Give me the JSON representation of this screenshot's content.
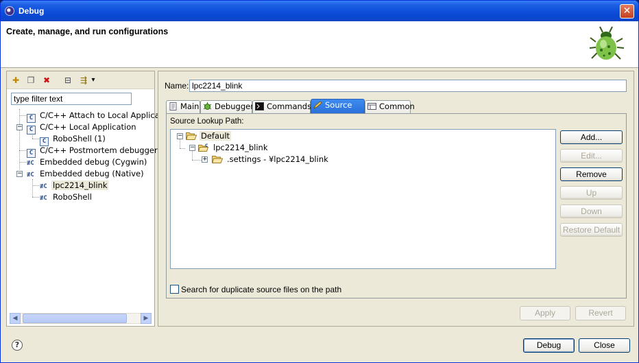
{
  "window": {
    "title": "Debug",
    "close_glyph": "✕"
  },
  "banner": {
    "title": "Create, manage, and run configurations",
    "icon": "bug-icon"
  },
  "left": {
    "toolbar": [
      {
        "name": "new-config-icon",
        "glyph": "✚"
      },
      {
        "name": "duplicate-icon",
        "glyph": "❐"
      },
      {
        "name": "delete-icon",
        "glyph": "✖"
      },
      {
        "name": "collapse-all-icon",
        "glyph": "⊟"
      },
      {
        "name": "filter-icon",
        "glyph": "⇶"
      },
      {
        "name": "dropdown-icon",
        "glyph": "▾"
      }
    ],
    "filter_text": "type filter text",
    "tree": [
      {
        "label": "C/C++ Attach to Local Applicat",
        "icon": "c-app-icon",
        "iconText": "C"
      },
      {
        "label": "C/C++ Local Application",
        "icon": "c-app-icon",
        "iconText": "C"
      },
      {
        "label": "RoboShell (1)",
        "icon": "c-app-icon",
        "iconText": "C"
      },
      {
        "label": "C/C++ Postmortem debugger",
        "icon": "c-app-icon",
        "iconText": "C"
      },
      {
        "label": "Embedded debug (Cygwin)",
        "icon": "embedded-icon",
        "iconText": "≢C"
      },
      {
        "label": "Embedded debug (Native)",
        "icon": "embedded-icon",
        "iconText": "≢C"
      },
      {
        "label": "lpc2214_blink",
        "icon": "embedded-icon",
        "iconText": "≢C"
      },
      {
        "label": "RoboShell",
        "icon": "embedded-icon",
        "iconText": "≢C"
      }
    ],
    "expand_minus": "−",
    "scroll_left": "◀",
    "scroll_right": "▶"
  },
  "right": {
    "name_label": "Name:",
    "name_value": "lpc2214_blink",
    "tabs": [
      {
        "label": "Main",
        "icon": "main-tab-icon"
      },
      {
        "label": "Debugger",
        "icon": "debugger-tab-icon"
      },
      {
        "label": "Commands",
        "icon": "commands-tab-icon"
      },
      {
        "label": "Source",
        "icon": "source-tab-icon"
      },
      {
        "label": "Common",
        "icon": "common-tab-icon"
      }
    ],
    "active_tab": "Source",
    "lookup_label": "Source Lookup Path:",
    "lookup_tree": [
      {
        "label": "Default"
      },
      {
        "label": "lpc2214_blink"
      },
      {
        "label": ".settings - ¥lpc2214_blink"
      }
    ],
    "side_buttons": [
      {
        "label": "Add...",
        "enabled": true
      },
      {
        "label": "Edit...",
        "enabled": false
      },
      {
        "label": "Remove",
        "enabled": true
      },
      {
        "label": "Up",
        "enabled": false
      },
      {
        "label": "Down",
        "enabled": false
      },
      {
        "label": "Restore Default",
        "enabled": false
      }
    ],
    "duplicate_check_label": "Search for duplicate source files on the path",
    "apply_label": "Apply",
    "revert_label": "Revert"
  },
  "footer": {
    "help_glyph": "?",
    "debug_label": "Debug",
    "close_label": "Close"
  },
  "colors": {
    "titlebar": "#0a44c8",
    "accent": "#3d8bf0"
  }
}
